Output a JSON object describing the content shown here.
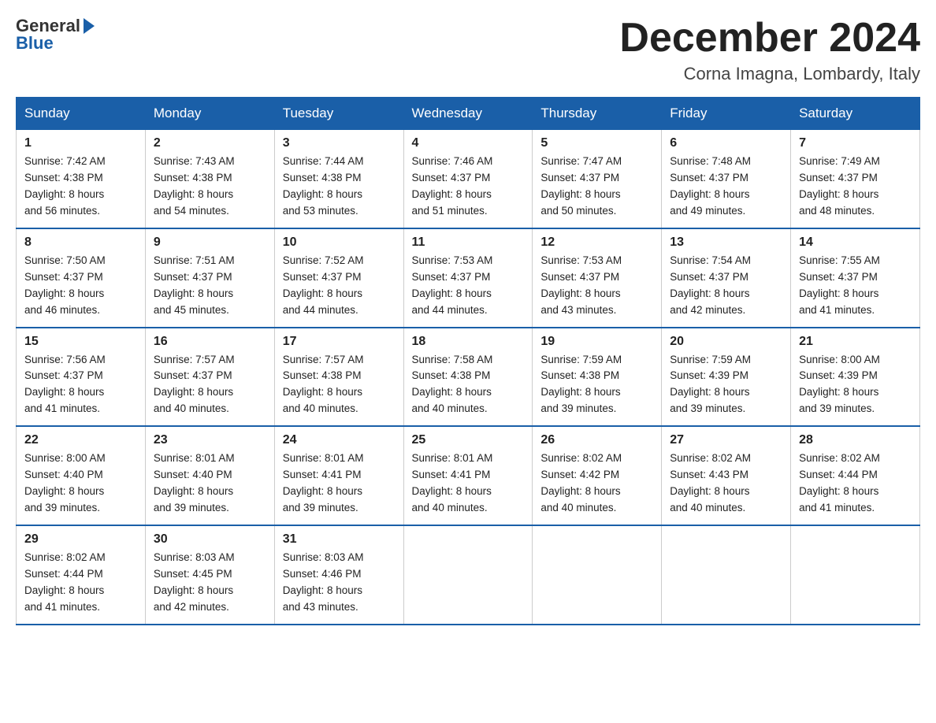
{
  "header": {
    "logo_general": "General",
    "logo_blue": "Blue",
    "month_title": "December 2024",
    "location": "Corna Imagna, Lombardy, Italy"
  },
  "weekdays": [
    "Sunday",
    "Monday",
    "Tuesday",
    "Wednesday",
    "Thursday",
    "Friday",
    "Saturday"
  ],
  "weeks": [
    [
      {
        "day": "1",
        "sunrise": "7:42 AM",
        "sunset": "4:38 PM",
        "daylight": "8 hours and 56 minutes."
      },
      {
        "day": "2",
        "sunrise": "7:43 AM",
        "sunset": "4:38 PM",
        "daylight": "8 hours and 54 minutes."
      },
      {
        "day": "3",
        "sunrise": "7:44 AM",
        "sunset": "4:38 PM",
        "daylight": "8 hours and 53 minutes."
      },
      {
        "day": "4",
        "sunrise": "7:46 AM",
        "sunset": "4:37 PM",
        "daylight": "8 hours and 51 minutes."
      },
      {
        "day": "5",
        "sunrise": "7:47 AM",
        "sunset": "4:37 PM",
        "daylight": "8 hours and 50 minutes."
      },
      {
        "day": "6",
        "sunrise": "7:48 AM",
        "sunset": "4:37 PM",
        "daylight": "8 hours and 49 minutes."
      },
      {
        "day": "7",
        "sunrise": "7:49 AM",
        "sunset": "4:37 PM",
        "daylight": "8 hours and 48 minutes."
      }
    ],
    [
      {
        "day": "8",
        "sunrise": "7:50 AM",
        "sunset": "4:37 PM",
        "daylight": "8 hours and 46 minutes."
      },
      {
        "day": "9",
        "sunrise": "7:51 AM",
        "sunset": "4:37 PM",
        "daylight": "8 hours and 45 minutes."
      },
      {
        "day": "10",
        "sunrise": "7:52 AM",
        "sunset": "4:37 PM",
        "daylight": "8 hours and 44 minutes."
      },
      {
        "day": "11",
        "sunrise": "7:53 AM",
        "sunset": "4:37 PM",
        "daylight": "8 hours and 44 minutes."
      },
      {
        "day": "12",
        "sunrise": "7:53 AM",
        "sunset": "4:37 PM",
        "daylight": "8 hours and 43 minutes."
      },
      {
        "day": "13",
        "sunrise": "7:54 AM",
        "sunset": "4:37 PM",
        "daylight": "8 hours and 42 minutes."
      },
      {
        "day": "14",
        "sunrise": "7:55 AM",
        "sunset": "4:37 PM",
        "daylight": "8 hours and 41 minutes."
      }
    ],
    [
      {
        "day": "15",
        "sunrise": "7:56 AM",
        "sunset": "4:37 PM",
        "daylight": "8 hours and 41 minutes."
      },
      {
        "day": "16",
        "sunrise": "7:57 AM",
        "sunset": "4:37 PM",
        "daylight": "8 hours and 40 minutes."
      },
      {
        "day": "17",
        "sunrise": "7:57 AM",
        "sunset": "4:38 PM",
        "daylight": "8 hours and 40 minutes."
      },
      {
        "day": "18",
        "sunrise": "7:58 AM",
        "sunset": "4:38 PM",
        "daylight": "8 hours and 40 minutes."
      },
      {
        "day": "19",
        "sunrise": "7:59 AM",
        "sunset": "4:38 PM",
        "daylight": "8 hours and 39 minutes."
      },
      {
        "day": "20",
        "sunrise": "7:59 AM",
        "sunset": "4:39 PM",
        "daylight": "8 hours and 39 minutes."
      },
      {
        "day": "21",
        "sunrise": "8:00 AM",
        "sunset": "4:39 PM",
        "daylight": "8 hours and 39 minutes."
      }
    ],
    [
      {
        "day": "22",
        "sunrise": "8:00 AM",
        "sunset": "4:40 PM",
        "daylight": "8 hours and 39 minutes."
      },
      {
        "day": "23",
        "sunrise": "8:01 AM",
        "sunset": "4:40 PM",
        "daylight": "8 hours and 39 minutes."
      },
      {
        "day": "24",
        "sunrise": "8:01 AM",
        "sunset": "4:41 PM",
        "daylight": "8 hours and 39 minutes."
      },
      {
        "day": "25",
        "sunrise": "8:01 AM",
        "sunset": "4:41 PM",
        "daylight": "8 hours and 40 minutes."
      },
      {
        "day": "26",
        "sunrise": "8:02 AM",
        "sunset": "4:42 PM",
        "daylight": "8 hours and 40 minutes."
      },
      {
        "day": "27",
        "sunrise": "8:02 AM",
        "sunset": "4:43 PM",
        "daylight": "8 hours and 40 minutes."
      },
      {
        "day": "28",
        "sunrise": "8:02 AM",
        "sunset": "4:44 PM",
        "daylight": "8 hours and 41 minutes."
      }
    ],
    [
      {
        "day": "29",
        "sunrise": "8:02 AM",
        "sunset": "4:44 PM",
        "daylight": "8 hours and 41 minutes."
      },
      {
        "day": "30",
        "sunrise": "8:03 AM",
        "sunset": "4:45 PM",
        "daylight": "8 hours and 42 minutes."
      },
      {
        "day": "31",
        "sunrise": "8:03 AM",
        "sunset": "4:46 PM",
        "daylight": "8 hours and 43 minutes."
      },
      null,
      null,
      null,
      null
    ]
  ],
  "labels": {
    "sunrise_prefix": "Sunrise: ",
    "sunset_prefix": "Sunset: ",
    "daylight_prefix": "Daylight: "
  }
}
